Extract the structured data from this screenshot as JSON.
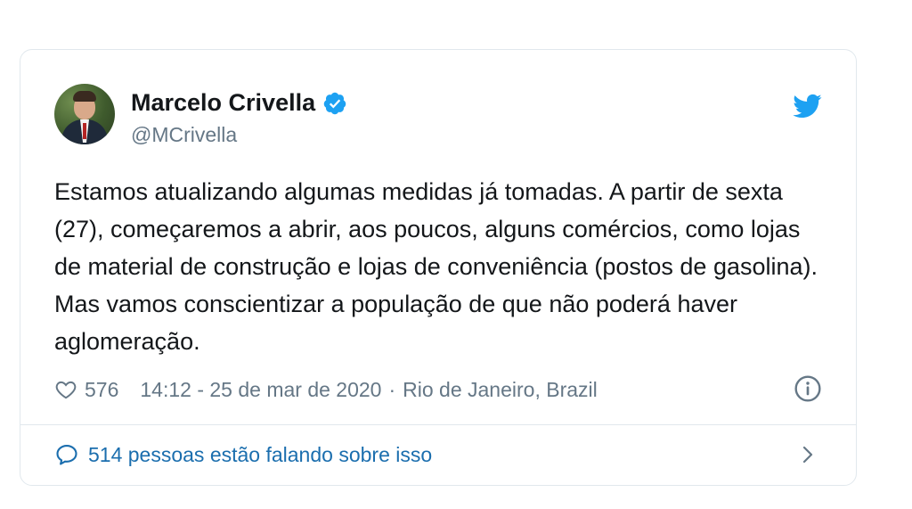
{
  "tweet": {
    "author_name": "Marcelo Crivella",
    "handle": "@MCrivella",
    "text": "Estamos atualizando algumas medidas já tomadas. A partir de sexta (27), começaremos a abrir, aos poucos, alguns comércios, como lojas de material de construção e lojas de conveniência (postos de gasolina). Mas vamos conscientizar a população de que não poderá haver aglomeração.",
    "likes": "576",
    "timestamp": "14:12 - 25 de mar de 2020",
    "separator": "·",
    "location": "Rio de Janeiro, Brazil",
    "conversation_label": "514 pessoas estão falando sobre isso"
  },
  "icons": {
    "verified": "verified-badge-icon",
    "brand": "twitter-bird-icon",
    "like": "heart-icon",
    "info": "info-icon",
    "conversation": "speech-bubble-icon",
    "chevron": "chevron-right-icon"
  },
  "colors": {
    "twitter_blue": "#1da1f2",
    "text_primary": "#14171a",
    "text_secondary": "#657786",
    "link_blue": "#1b6eae",
    "border": "#e1e8ed"
  }
}
